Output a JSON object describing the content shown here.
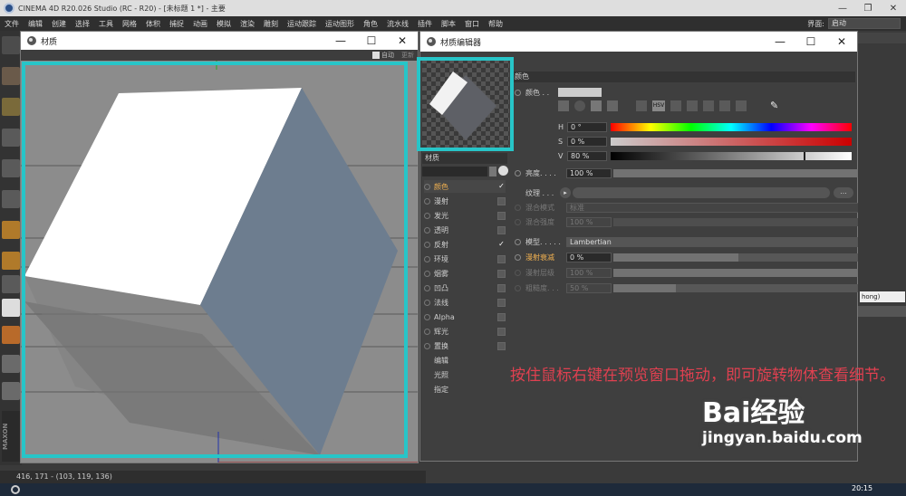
{
  "titlebar": {
    "title": "CINEMA 4D R20.026 Studio (RC - R20) - [未标题 1 *] - 主要",
    "minimize": "—",
    "maximize": "❐",
    "close": "✕"
  },
  "menubar": {
    "items": [
      "文件",
      "编辑",
      "创建",
      "选择",
      "工具",
      "网格",
      "体积",
      "捕捉",
      "动画",
      "模拟",
      "渲染",
      "雕刻",
      "运动跟踪",
      "运动图形",
      "角色",
      "流水线",
      "插件",
      "脚本",
      "窗口",
      "帮助"
    ],
    "layout_label": "界面:",
    "layout_value": "启动"
  },
  "material_window": {
    "title": "材质",
    "min": "—",
    "max": "☐",
    "close": "✕",
    "auto_label": "自动",
    "other_label": "更新"
  },
  "editor_window": {
    "title": "材质编辑器",
    "min": "—",
    "max": "☐",
    "close": "✕"
  },
  "channels": {
    "name_label": "材质",
    "items": [
      {
        "label": "颜色",
        "checked": true,
        "active": true
      },
      {
        "label": "漫射",
        "checked": false
      },
      {
        "label": "发光",
        "checked": false
      },
      {
        "label": "透明",
        "checked": false
      },
      {
        "label": "反射",
        "checked": true
      },
      {
        "label": "环境",
        "checked": false
      },
      {
        "label": "烟雾",
        "checked": false
      },
      {
        "label": "凹凸",
        "checked": false
      },
      {
        "label": "法线",
        "checked": false
      },
      {
        "label": "Alpha",
        "checked": false
      },
      {
        "label": "辉光",
        "checked": false
      },
      {
        "label": "置换",
        "checked": false
      },
      {
        "label": "编辑"
      },
      {
        "label": "光照"
      },
      {
        "label": "指定"
      }
    ]
  },
  "color_section": {
    "header": "颜色",
    "color_label": "颜色 . .",
    "h_label": "H",
    "h_value": "0 °",
    "s_label": "S",
    "s_value": "0 %",
    "v_label": "V",
    "v_value": "80 %",
    "brightness_label": "亮度. . . .",
    "brightness_value": "100 %",
    "texture_label": "纹理 . . .",
    "texture_btn": "...",
    "blend_mode_label": "混合模式",
    "blend_mode_value": "标准",
    "blend_strength_label": "混合强度",
    "blend_strength_value": "100 %",
    "model_label": "模型. . . . .",
    "model_value": "Lambertian",
    "diffuse_falloff_label": "漫射衰减",
    "diffuse_falloff_value": "0 %",
    "diffuse_level_label": "漫射层级",
    "diffuse_level_value": "100 %",
    "roughness_label": "粗糙度. . .",
    "roughness_value": "50 %"
  },
  "side": {
    "phong": "hong)"
  },
  "statusbar": {
    "text": "416, 171 - (103, 119, 136)"
  },
  "instruction": {
    "text": "按住鼠标右键在预览窗口拖动，即可旋转物体查看细节。"
  },
  "watermark": {
    "logo": "Bai经验",
    "url": "jingyan.baidu.com"
  },
  "taskbar": {
    "time": "20:15"
  },
  "colors": {
    "accent": "#27c5c8",
    "instruction": "#e04050"
  }
}
